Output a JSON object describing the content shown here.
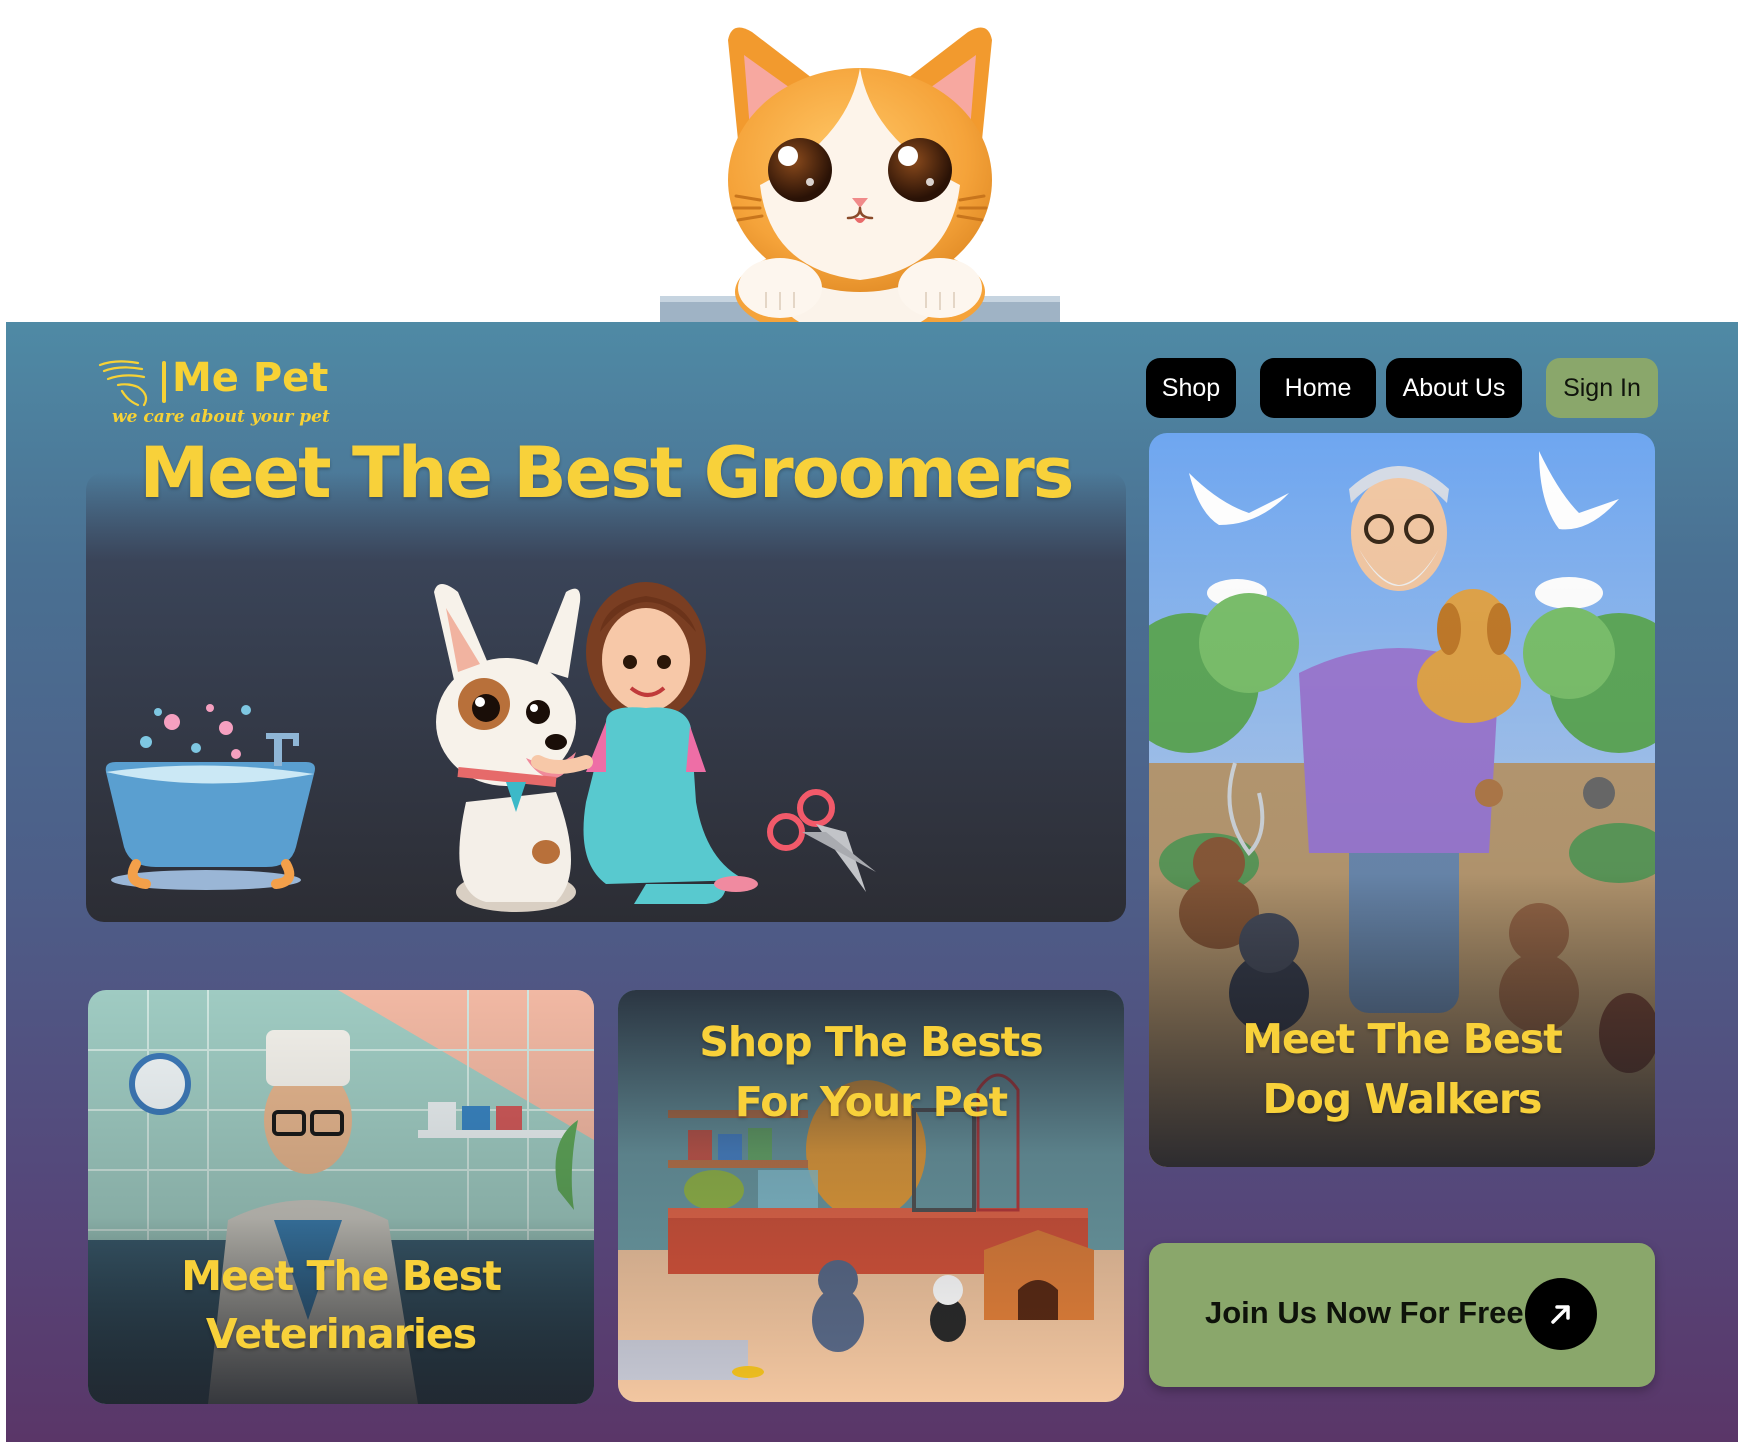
{
  "brand": {
    "name": "Me Pet",
    "tagline": "we  care about your pet",
    "accent_color": "#f7d235"
  },
  "nav": {
    "items": [
      {
        "label": "Shop"
      },
      {
        "label": "Home"
      },
      {
        "label": "About Us"
      },
      {
        "label": "Sign In"
      }
    ]
  },
  "cards": {
    "groomers": {
      "title": "Meet The Best Groomers",
      "icon": "groomer-dog-illustration"
    },
    "veterinaries": {
      "line1": "Meet The Best",
      "line2": "Veterinaries",
      "icon": "veterinarian-illustration"
    },
    "shop": {
      "line1": "Shop The Bests",
      "line2": "For Your Pet",
      "icon": "pet-shop-illustration"
    },
    "walkers": {
      "line1": "Meet The Best",
      "line2": "Dog Walkers",
      "icon": "dog-walker-illustration"
    }
  },
  "cta": {
    "label": "Join Us Now For Free",
    "icon": "arrow-up-right-icon",
    "color": "#8aa76b"
  },
  "colors": {
    "nav_bg": "#000000",
    "signin_bg": "#8aa76b",
    "headline": "#f8d13a"
  }
}
